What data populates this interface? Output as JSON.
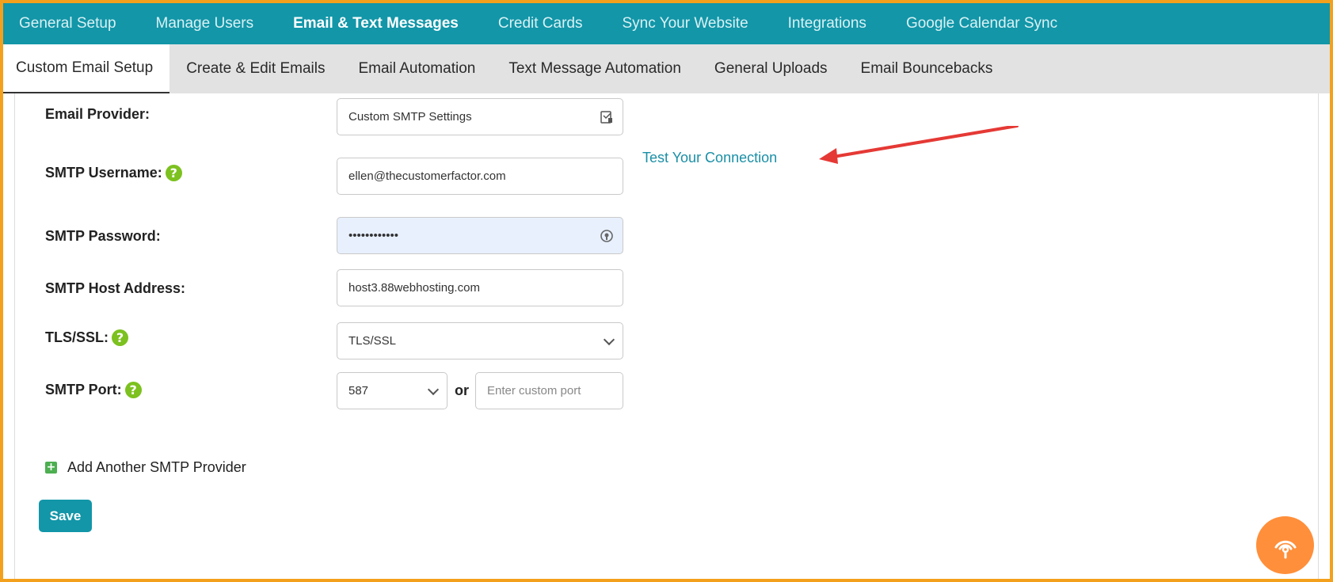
{
  "top_nav": {
    "tabs": [
      {
        "label": "General Setup"
      },
      {
        "label": "Manage Users"
      },
      {
        "label": "Email & Text Messages"
      },
      {
        "label": "Credit Cards"
      },
      {
        "label": "Sync Your Website"
      },
      {
        "label": "Integrations"
      },
      {
        "label": "Google Calendar Sync"
      }
    ],
    "active": "Email & Text Messages"
  },
  "sub_nav": {
    "tabs": [
      {
        "label": "Custom Email Setup"
      },
      {
        "label": "Create & Edit Emails"
      },
      {
        "label": "Email Automation"
      },
      {
        "label": "Text Message Automation"
      },
      {
        "label": "General Uploads"
      },
      {
        "label": "Email Bouncebacks"
      }
    ],
    "active": "Custom Email Setup"
  },
  "form": {
    "email_provider": {
      "label": "Email Provider:",
      "value": "Custom SMTP Settings"
    },
    "smtp_username": {
      "label": "SMTP Username:",
      "value": "ellen@thecustomerfactor.com"
    },
    "smtp_password": {
      "label": "SMTP Password:",
      "value": "••••••••••••"
    },
    "smtp_host": {
      "label": "SMTP Host Address:",
      "value": "host3.88webhosting.com"
    },
    "tls_ssl": {
      "label": "TLS/SSL:",
      "value": "TLS/SSL"
    },
    "smtp_port": {
      "label": "SMTP Port:",
      "value": "587",
      "or_text": "or",
      "custom_placeholder": "Enter custom port"
    },
    "test_connection_link": "Test Your Connection",
    "add_provider": "Add Another SMTP Provider",
    "save_label": "Save",
    "help_glyph": "?"
  },
  "colors": {
    "top_nav_bg": "#1296a8",
    "sub_nav_bg": "#e2e2e2",
    "accent": "#1296a8",
    "help_green": "#7cc11f",
    "arrow_red": "#e53935",
    "fab_orange": "#ff8f3a",
    "frame_border": "#f3a11c"
  },
  "icons": {
    "provider_field": "contact-card-icon",
    "password_field": "key-icon",
    "fab": "broadcast-icon"
  }
}
